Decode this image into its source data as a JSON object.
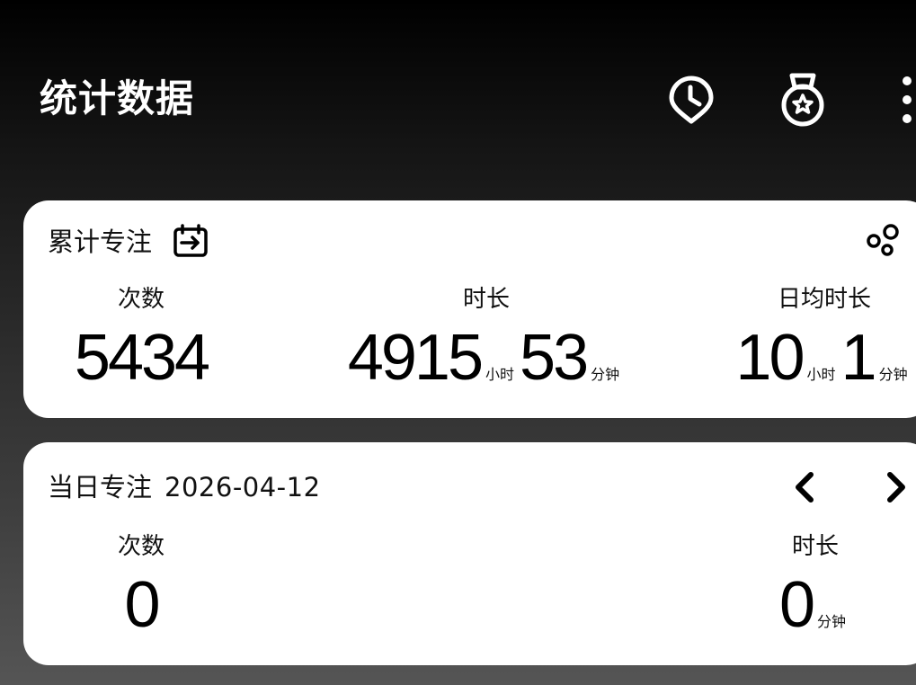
{
  "header": {
    "title": "统计数据",
    "icons": [
      "clock-pin-icon",
      "medal-star-icon",
      "more-vertical-icon"
    ]
  },
  "total_card": {
    "title": "累计专注",
    "title_icon": "calendar-arrow-icon",
    "action_icon": "bubbles-icon",
    "count": {
      "label": "次数",
      "value": "5434"
    },
    "duration": {
      "label": "时长",
      "hours": "4915",
      "hours_unit": "小时",
      "minutes": "53",
      "minutes_unit": "分钟"
    },
    "daily_avg": {
      "label": "日均时长",
      "hours": "10",
      "hours_unit": "小时",
      "minutes": "1",
      "minutes_unit": "分钟"
    }
  },
  "daily_card": {
    "title": "当日专注",
    "date": "2026-04-12",
    "prev_icon": "chevron-left-icon",
    "next_icon": "chevron-right-icon",
    "count": {
      "label": "次数",
      "value": "0"
    },
    "duration": {
      "label": "时长",
      "minutes": "0",
      "minutes_unit": "分钟"
    }
  },
  "colors": {
    "card_bg": "#ffffff",
    "text": "#000000",
    "header_text": "#ffffff"
  }
}
